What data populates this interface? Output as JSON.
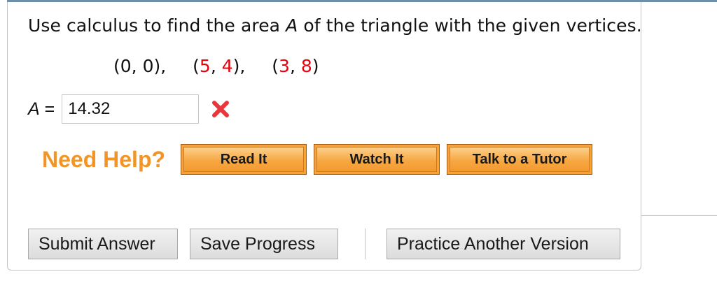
{
  "question": {
    "prefix": "Use calculus to find the area ",
    "variable": "A",
    "suffix": " of the triangle with the given vertices."
  },
  "vertices": [
    {
      "open": "(",
      "x": "0",
      "sep": ", ",
      "y": "0",
      "close": "),",
      "x_color": "#111111",
      "y_color": "#111111"
    },
    {
      "open": "(",
      "x": "5",
      "sep": ", ",
      "y": "4",
      "close": "),",
      "x_color": "#e8000b",
      "y_color": "#e8000b"
    },
    {
      "open": "(",
      "x": "3",
      "sep": ", ",
      "y": "8",
      "close": ")",
      "x_color": "#e8000b",
      "y_color": "#e8000b"
    }
  ],
  "answer": {
    "variable": "A",
    "equals": " = ",
    "value": "14.32",
    "status_icon": "x-mark-icon",
    "status_color": "#e8383d"
  },
  "help": {
    "label": "Need Help?",
    "label_color": "#f39426",
    "buttons": {
      "read": "Read It",
      "watch": "Watch It",
      "tutor": "Talk to a Tutor"
    }
  },
  "actions": {
    "submit": "Submit Answer",
    "save": "Save Progress",
    "practice": "Practice Another Version"
  }
}
